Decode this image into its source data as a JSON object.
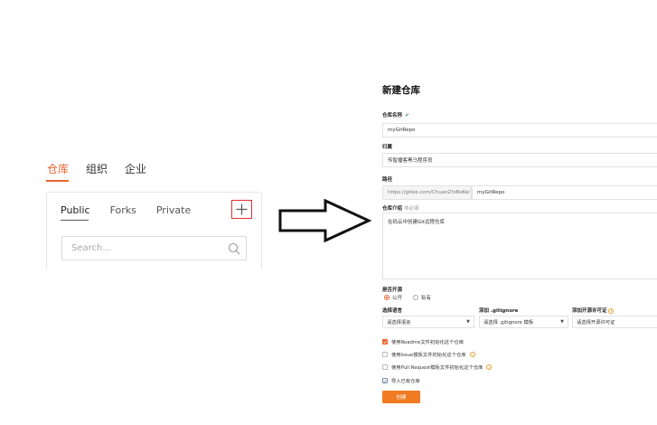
{
  "left": {
    "top_tabs": [
      "仓库",
      "组织",
      "企业"
    ],
    "sub_tabs": [
      "Public",
      "Forks",
      "Private"
    ],
    "search_placeholder": "Search..."
  },
  "form": {
    "title": "新建仓库",
    "name_label": "仓库名称",
    "name_value": "myGitRepo",
    "owner_label": "归属",
    "owner_value": "传智播客黑马程序员",
    "path_label": "路径",
    "path_prefix": "https://gitee.com/ChuanZhiBoKe/",
    "path_value": "myGitRepo",
    "desc_label": "仓库介绍",
    "desc_muted": "非必填",
    "desc_value": "在码云中创建Git远程仓库",
    "open_label": "是否开源",
    "radio_public": "公开",
    "radio_private": "私有",
    "lang_label": "选择语言",
    "lang_value": "请选择语言",
    "gitignore_label": "添加 .gitignore",
    "gitignore_value": "请选择 .gitignore 模板",
    "license_label": "添加开源许可证",
    "license_value": "请选择开源许可证",
    "cb_readme": "使用Readme文件初始化这个仓库",
    "cb_issue": "使用Issue模板文件初始化这个仓库",
    "cb_pr": "使用Pull Request模板文件初始化这个仓库",
    "cb_import": "导入已有仓库",
    "create_label": "创建"
  },
  "colors": {
    "accent": "#e8652e",
    "highlight_border": "#e03030",
    "button": "#f07b23"
  }
}
